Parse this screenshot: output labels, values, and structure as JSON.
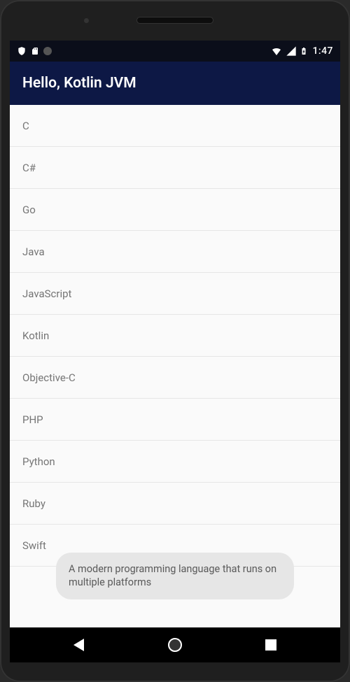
{
  "status_bar": {
    "time": "1:47"
  },
  "app_bar": {
    "title": "Hello, Kotlin JVM"
  },
  "list": {
    "items": [
      {
        "label": "C"
      },
      {
        "label": "C#"
      },
      {
        "label": "Go"
      },
      {
        "label": "Java"
      },
      {
        "label": "JavaScript"
      },
      {
        "label": "Kotlin"
      },
      {
        "label": "Objective-C"
      },
      {
        "label": "PHP"
      },
      {
        "label": "Python"
      },
      {
        "label": "Ruby"
      },
      {
        "label": "Swift"
      }
    ]
  },
  "toast": {
    "message": "A modern programming language that runs on multiple platforms"
  }
}
